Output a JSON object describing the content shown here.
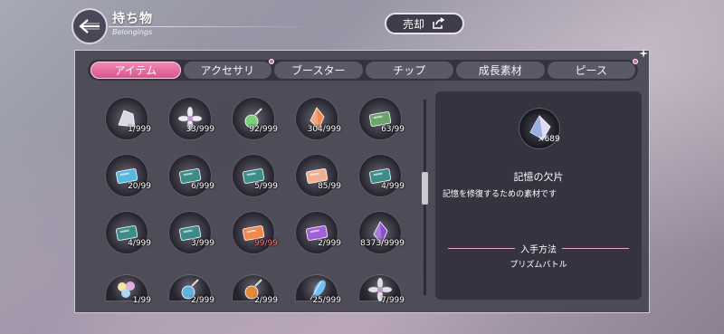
{
  "header": {
    "title": "持ち物",
    "subtitle": "Belongings",
    "sell_label": "売却"
  },
  "tabs": [
    {
      "label": "アイテム",
      "active": true,
      "badge": false
    },
    {
      "label": "アクセサリ",
      "active": false,
      "badge": true
    },
    {
      "label": "ブースター",
      "active": false,
      "badge": false
    },
    {
      "label": "チップ",
      "active": false,
      "badge": false
    },
    {
      "label": "成長素材",
      "active": false,
      "badge": false
    },
    {
      "label": "ピース",
      "active": false,
      "badge": true
    }
  ],
  "items": [
    {
      "count": "1/999",
      "icon": "silver-shard-icon",
      "color": "#d8d8e0"
    },
    {
      "count": "33/999",
      "icon": "white-flower-icon",
      "color": "#f0e8f6"
    },
    {
      "count": "92/999",
      "icon": "rainbow-pendant-icon",
      "color": "#7ad07a"
    },
    {
      "count": "304/999",
      "icon": "orange-crystal-icon",
      "color": "#f08a50"
    },
    {
      "count": "63/99",
      "icon": "green-ticket-icon",
      "color": "#6aa46a"
    },
    {
      "count": "20/99",
      "icon": "blue-ticket-icon",
      "color": "#58b8e0"
    },
    {
      "count": "6/999",
      "icon": "teal-ticket-icon",
      "color": "#3c8c8a"
    },
    {
      "count": "5/999",
      "icon": "teal-ticket-icon",
      "color": "#3c8c8a"
    },
    {
      "count": "85/99",
      "icon": "peach-ticket-icon",
      "color": "#f0b090"
    },
    {
      "count": "4/999",
      "icon": "teal-ticket-icon",
      "color": "#3c8c8a"
    },
    {
      "count": "4/999",
      "icon": "teal-ticket-icon",
      "color": "#3c8c8a"
    },
    {
      "count": "3/999",
      "icon": "teal-ticket-icon",
      "color": "#3c8c8a"
    },
    {
      "count": "99/99",
      "icon": "orange-ticket-icon",
      "color": "#f08850",
      "full": true
    },
    {
      "count": "2/999",
      "icon": "purple-ticket-icon",
      "color": "#a060d8"
    },
    {
      "count": "8373/9999",
      "icon": "purple-crystal-icon",
      "color": "#8850d0"
    },
    {
      "count": "1/99",
      "icon": "bouquet-icon",
      "color": "#e8d890"
    },
    {
      "count": "2/999",
      "icon": "blue-potion-icon",
      "color": "#60b0e0"
    },
    {
      "count": "2/999",
      "icon": "orange-potion-icon",
      "color": "#e08a3a"
    },
    {
      "count": "25/999",
      "icon": "blue-feather-icon",
      "color": "#70c0f0"
    },
    {
      "count": "7/999",
      "icon": "silver-leaf-icon",
      "color": "#e0e0e8"
    }
  ],
  "detail": {
    "icon": "prism-shard-icon",
    "quantity": "×689",
    "name": "記憶の欠片",
    "description": "記憶を修復するための素材です",
    "obtain_title": "入手方法",
    "obtain_value": "プリズムバトル"
  },
  "colors": {
    "accent": "#e35fa3",
    "panel": "#4a4854"
  }
}
